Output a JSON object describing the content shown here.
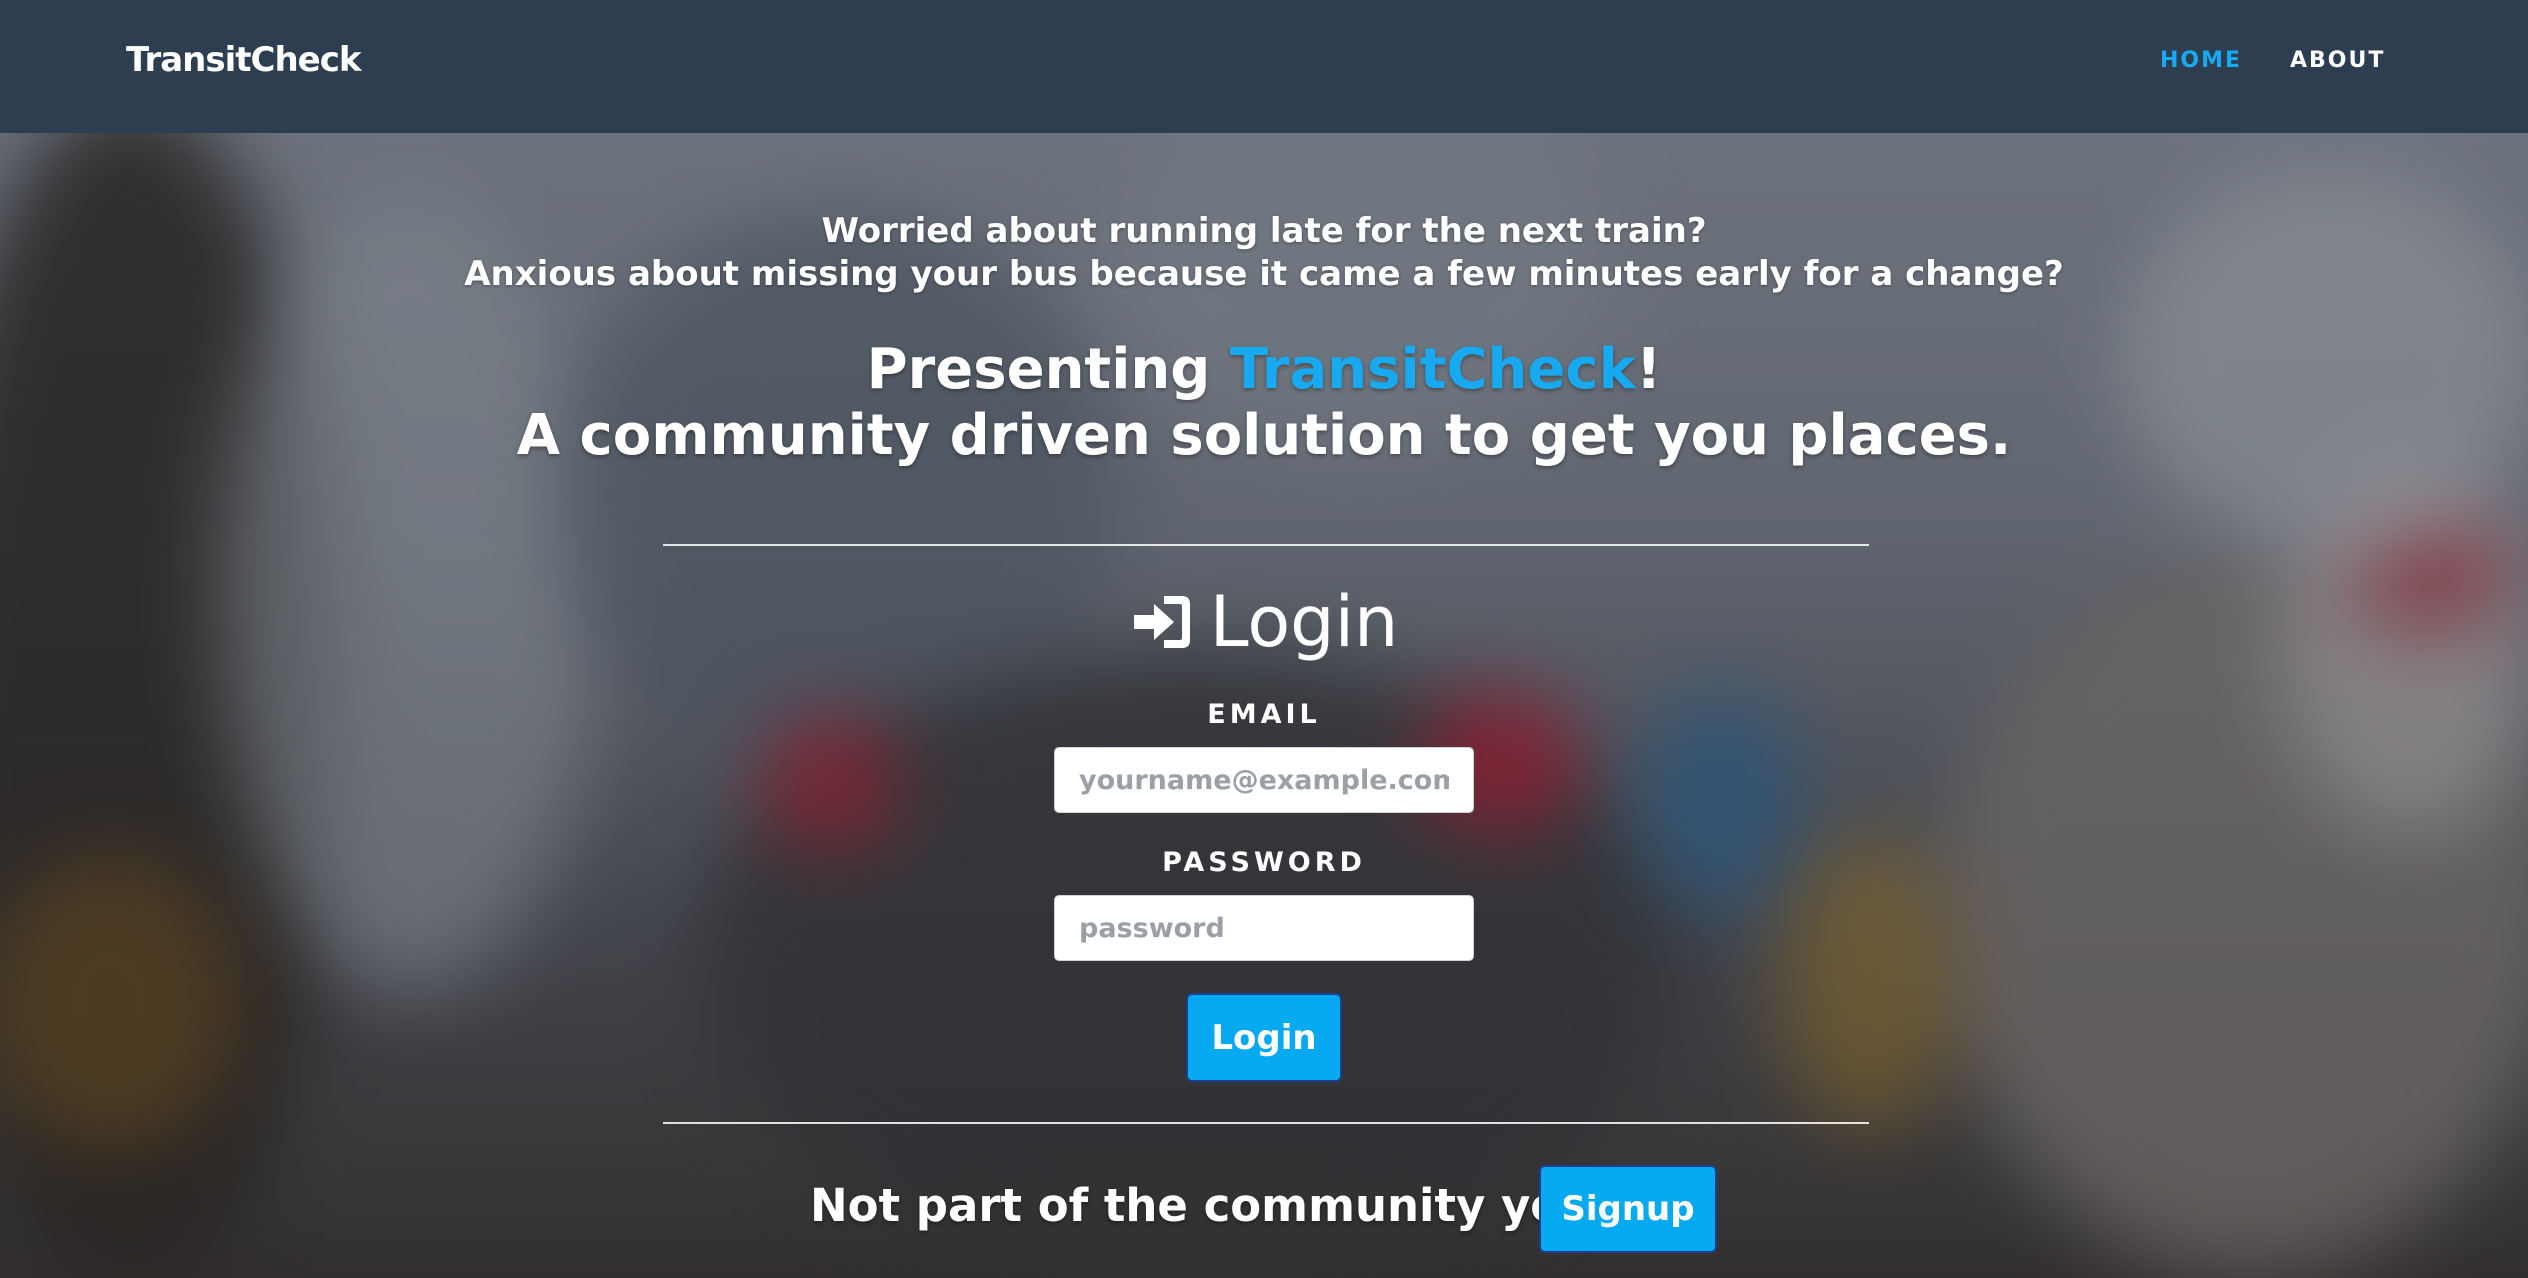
{
  "navbar": {
    "brand": "TransitCheck",
    "links": [
      {
        "label": "HOME",
        "active": true
      },
      {
        "label": "ABOUT",
        "active": false
      }
    ]
  },
  "hero": {
    "tagline_1": "Worried about running late for the next train?",
    "tagline_2": "Anxious about missing your bus because it came a few minutes early for a change?",
    "headline_prefix": "Presenting ",
    "headline_brand": "TransitCheck",
    "headline_suffix": "!",
    "headline_2": "A community driven solution to get you places."
  },
  "login": {
    "title": "Login",
    "icon": "sign-in-icon",
    "email_label": "EMAIL",
    "email_placeholder": "yourname@example.com",
    "email_value": "",
    "password_label": "PASSWORD",
    "password_placeholder": "password",
    "password_value": "",
    "submit_label": "Login"
  },
  "signup": {
    "prompt": "Not part of the community yet?",
    "button_label": "Signup"
  },
  "colors": {
    "navbar_bg": "#2c3e50",
    "accent": "#18aaf1",
    "button_bg": "#07a9f0",
    "button_border": "#1f3c8f"
  }
}
